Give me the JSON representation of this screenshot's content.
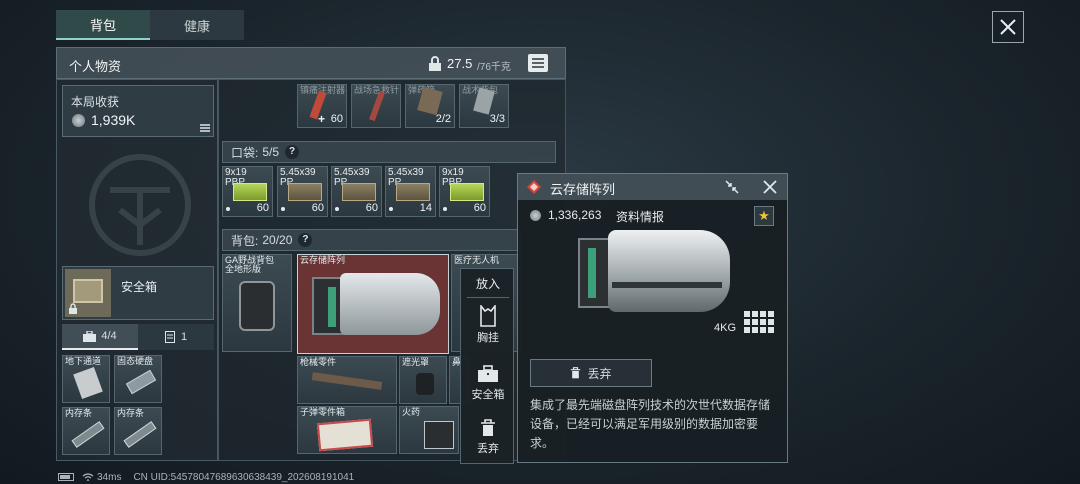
{
  "tabs": [
    "背包",
    "健康"
  ],
  "inventory": {
    "title": "个人物资",
    "weight": "27.5",
    "weight_max": "/76千克"
  },
  "loot": {
    "label": "本局收获",
    "value": "1,939K"
  },
  "safe_box": {
    "label": "安全箱",
    "tab_a": "4/4",
    "tab_b": "1",
    "items": [
      "地下通道",
      "固态硬盘",
      "内存条",
      "内存条"
    ]
  },
  "top_row": {
    "labels": [
      "镇痛注射器",
      "战场急救针",
      "弹药箱",
      "战术背包"
    ],
    "counts": [
      "60",
      "",
      "2/2",
      "3/3"
    ]
  },
  "pocket": {
    "label": "口袋:",
    "count": "5/5",
    "items": [
      {
        "cal": "9x19",
        "type": "PBP",
        "count": "60"
      },
      {
        "cal": "5.45x39",
        "type": "PP",
        "count": "60"
      },
      {
        "cal": "5.45x39",
        "type": "PP",
        "count": "60"
      },
      {
        "cal": "5.45x39",
        "type": "PP",
        "count": "14"
      },
      {
        "cal": "9x19",
        "type": "PBP",
        "count": "60"
      }
    ]
  },
  "backpack": {
    "label": "背包:",
    "count": "20/20",
    "items": [
      "GA野战背包\n全地形版",
      "云存储阵列",
      "医疗无人机",
      "枪械零件",
      "遮光罩",
      "鼻",
      "子弹零件箱",
      "火药"
    ]
  },
  "context_menu": {
    "title": "放入",
    "items": [
      "胸挂",
      "安全箱",
      "丢弃"
    ]
  },
  "detail": {
    "title": "云存储阵列",
    "value": "1,336,263",
    "info_label": "资料情报",
    "weight": "4KG",
    "discard": "丢弃",
    "description": "集成了最先端磁盘阵列技术的次世代数据存储设备，已经可以满足军用级别的数据加密要求。"
  },
  "status": {
    "ping": "34ms",
    "uid": "CN UID:5457804768963063843​9_202608191041"
  },
  "colors": {
    "selected_bg": "#6a3434",
    "accent_red": "#d8443a",
    "ammo_green": "#a6c84a",
    "star": "#f2c23a"
  }
}
